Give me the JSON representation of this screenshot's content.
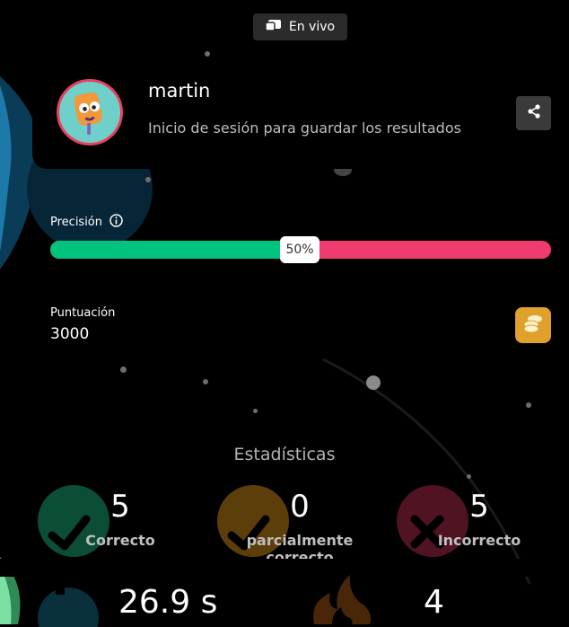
{
  "live": {
    "label": "En vivo"
  },
  "player": {
    "name": "martin",
    "login_message": "Inicio de sesión para guardar los resultados"
  },
  "accuracy": {
    "label": "Precisión",
    "percent": 50,
    "percent_text": "50%"
  },
  "score": {
    "label": "Puntuación",
    "value": "3000"
  },
  "stats": {
    "title": "Estadísticas",
    "correct": {
      "value": "5",
      "label": "Correcto"
    },
    "partial": {
      "value": "0",
      "label": "parcialmente correcto"
    },
    "incorrect": {
      "value": "5",
      "label": "Incorrecto"
    },
    "time": {
      "value": "26.9 s"
    },
    "streak": {
      "value": "4"
    }
  },
  "colors": {
    "correct": "#00c47d",
    "incorrect": "#ef3c6c",
    "coin": "#e0a02c"
  },
  "icons": [
    "live-icon",
    "share-icon",
    "info-icon",
    "coins-icon",
    "check-icon",
    "cross-icon",
    "timer-icon",
    "flame-icon"
  ]
}
